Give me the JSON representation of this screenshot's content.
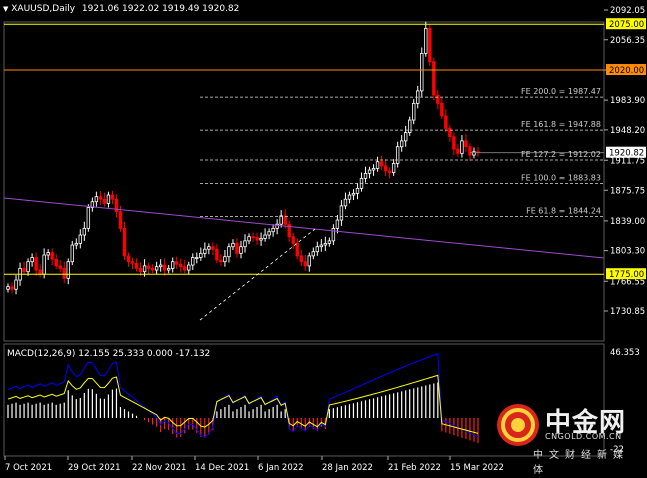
{
  "header": {
    "symbol": "XAUUSD,Daily",
    "ohlc": "1921.06 1922.02 1919.49 1920.82"
  },
  "price_axis": {
    "ticks": [
      "2092.05",
      "2056.35",
      "2020.00",
      "1983.90",
      "1948.20",
      "1911.75",
      "1875.75",
      "1839.00",
      "1803.30",
      "1766.55",
      "1730.85"
    ],
    "highlight_labels": [
      {
        "text": "2075.00",
        "value": 2075.0,
        "color": "#ffff00"
      },
      {
        "text": "2020.00",
        "value": 2020.0,
        "color": "#ff8c00"
      },
      {
        "text": "1775.00",
        "value": 1775.0,
        "color": "#ffff00"
      }
    ],
    "current_price": {
      "text": "1920.82",
      "value": 1920.82
    }
  },
  "fib_levels": [
    {
      "label": "FE 200.0 = 1987.47",
      "value": 1987.47
    },
    {
      "label": "FE 161.8 = 1947.88",
      "value": 1947.88
    },
    {
      "label": "FE 127.2 = 1912.02",
      "value": 1912.02
    },
    {
      "label": "FE 100.0 = 1883.83",
      "value": 1883.83
    },
    {
      "label": "FE 61.8 = 1844.24",
      "value": 1844.24
    }
  ],
  "macd": {
    "title": "MACD(12,26,9) 12.155 25.333 0.000 -17.132",
    "axis_top": "46.353",
    "axis_bottom": "-22"
  },
  "time_axis": [
    "7 Oct 2021",
    "29 Oct 2021",
    "22 Nov 2021",
    "14 Dec 2021",
    "6 Jan 2022",
    "28 Jan 2022",
    "21 Feb 2022",
    "15 Mar 2022"
  ],
  "watermark": {
    "title": "中金网",
    "subtitle": "CNGOLD.COM.CN",
    "tagline": "中文财经新媒体"
  },
  "colors": {
    "background": "#000000",
    "bull": "#ffffff",
    "bear": "#ff0000",
    "macd_main": "#0000ff",
    "macd_signal": "#ffff00",
    "trendline": "#9b4dca",
    "grid_text": "#ffffff"
  }
}
